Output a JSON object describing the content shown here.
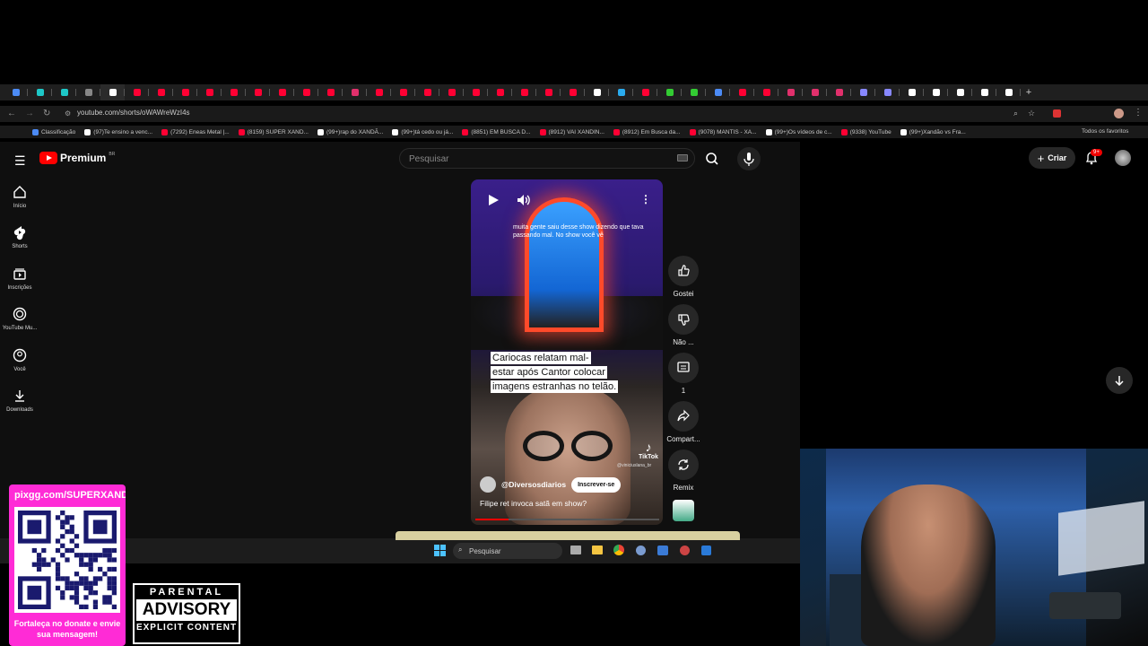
{
  "browser": {
    "url": "youtube.com/shorts/oWAWreWzI4s",
    "tab_colors": [
      "#4c8bf5",
      "#1ec8c8",
      "#1ec8c8",
      "#888",
      "#ffffff",
      "#ff0033",
      "#ff0033",
      "#ff0033",
      "#ff0033",
      "#ff0033",
      "#ff0033",
      "#ff0033",
      "#ff0033",
      "#ff0033",
      "#e1306c",
      "#ff0033",
      "#ff0033",
      "#ff0033",
      "#ff0033",
      "#ff0033",
      "#ff0033",
      "#ff0033",
      "#ff0033",
      "#ff0033",
      "#ffffff",
      "#2aabee",
      "#ff0033",
      "#33cc33",
      "#33cc33",
      "#4c8bf5",
      "#ff0033",
      "#ff0033",
      "#e1306c",
      "#e1306c",
      "#e1306c",
      "#8888ff",
      "#8888ff",
      "#ffffff",
      "#ffffff",
      "#ffffff",
      "#ffffff",
      "#ffffff"
    ],
    "new_tab": "+",
    "bookmarks": [
      {
        "label": "Classificação",
        "color": "#4c8bf5"
      },
      {
        "label": "(97)Te ensino a venc...",
        "color": "#ffffff"
      },
      {
        "label": "(7292) Eneas Metal |...",
        "color": "#ff0033"
      },
      {
        "label": "(8159) SUPER XAND...",
        "color": "#ff0033"
      },
      {
        "label": "(99+)rap do XANDÃ...",
        "color": "#ffffff"
      },
      {
        "label": "(99+)tá cedo ou já...",
        "color": "#ffffff"
      },
      {
        "label": "(8851) EM BUSCA D...",
        "color": "#ff0033"
      },
      {
        "label": "(8912) VAI XANDIN...",
        "color": "#ff0033"
      },
      {
        "label": "(8912) Em Busca da...",
        "color": "#ff0033"
      },
      {
        "label": "(9078) MANTIS - XA...",
        "color": "#ff0033"
      },
      {
        "label": "(99+)Os vídeos de c...",
        "color": "#ffffff"
      },
      {
        "label": "(9338) YouTube",
        "color": "#ff0033"
      },
      {
        "label": "(99+)Xandão vs Fra...",
        "color": "#ffffff"
      }
    ],
    "all_bookmarks": "Todos os favoritos"
  },
  "youtube": {
    "logo": "Premium",
    "region": "BR",
    "search_placeholder": "Pesquisar",
    "create_label": "Criar",
    "notifications": "9+",
    "nav": [
      {
        "label": "Início",
        "icon": "home-icon"
      },
      {
        "label": "Shorts",
        "icon": "shorts-icon"
      },
      {
        "label": "Inscrições",
        "icon": "subscriptions-icon"
      },
      {
        "label": "YouTube Mu...",
        "icon": "youtube-music-icon"
      },
      {
        "label": "Você",
        "icon": "you-icon"
      },
      {
        "label": "Downloads",
        "icon": "downloads-icon"
      }
    ],
    "short": {
      "caption": "muita gente saiu desse show dizendo que tava passando mal. No show você vê",
      "headline": [
        "Cariocas relatam mal-",
        "estar após Cantor colocar",
        "imagens estranhas no telão."
      ],
      "watermark": "TikTok",
      "watermark_user": "@viniciuslana_br",
      "channel": "@Diversosdiarios",
      "subscribe": "Inscrever-se",
      "title": "Filipe ret invoca satã em show?",
      "progress": 0.18
    },
    "actions": [
      {
        "label": "Gostei",
        "icon": "like-icon"
      },
      {
        "label": "Não ...",
        "icon": "dislike-icon"
      },
      {
        "label": "1",
        "icon": "comments-icon"
      },
      {
        "label": "Compart...",
        "icon": "share-icon"
      },
      {
        "label": "Remix",
        "icon": "remix-icon"
      }
    ]
  },
  "taskbar": {
    "search_placeholder": "Pesquisar"
  },
  "overlay": {
    "pix_url": "pixgg.com/SUPERXANDÃO",
    "donate_message": "Fortaleça no donate e envie sua mensagem!",
    "advisory_top": "PARENTAL",
    "advisory_mid": "ADVISORY",
    "advisory_bottom": "EXPLICIT CONTENT"
  }
}
